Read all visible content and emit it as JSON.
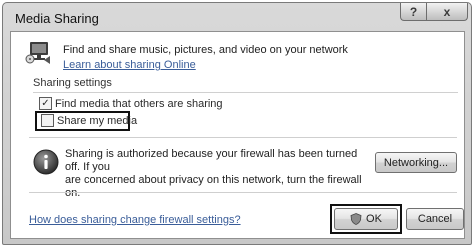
{
  "window": {
    "title": "Media Sharing",
    "help_button": "?",
    "close_button": "x"
  },
  "header": {
    "description": "Find and share music, pictures, and video on your network",
    "learn_link": "Learn about sharing Online"
  },
  "sharing_settings": {
    "label": "Sharing settings",
    "find_media": {
      "label": "Find media that others are sharing",
      "checked": true,
      "check_glyph": "✓"
    },
    "share_media": {
      "label": "Share my media",
      "checked": false
    }
  },
  "firewall_info": {
    "line1": "Sharing is authorized because your firewall has been turned off. If you",
    "line2": "are concerned about privacy on this network, turn the firewall on.",
    "networking_button": "Networking..."
  },
  "footer": {
    "firewall_link": "How does sharing change firewall settings?",
    "ok_button": "OK",
    "cancel_button": "Cancel"
  },
  "icons": [
    "media-sharing-icon",
    "info-icon",
    "shield-icon",
    "help-icon",
    "close-icon"
  ],
  "colors": {
    "link": "#3a5d99",
    "window_frame": "#c8c8c8",
    "client_bg": "#ffffff"
  }
}
